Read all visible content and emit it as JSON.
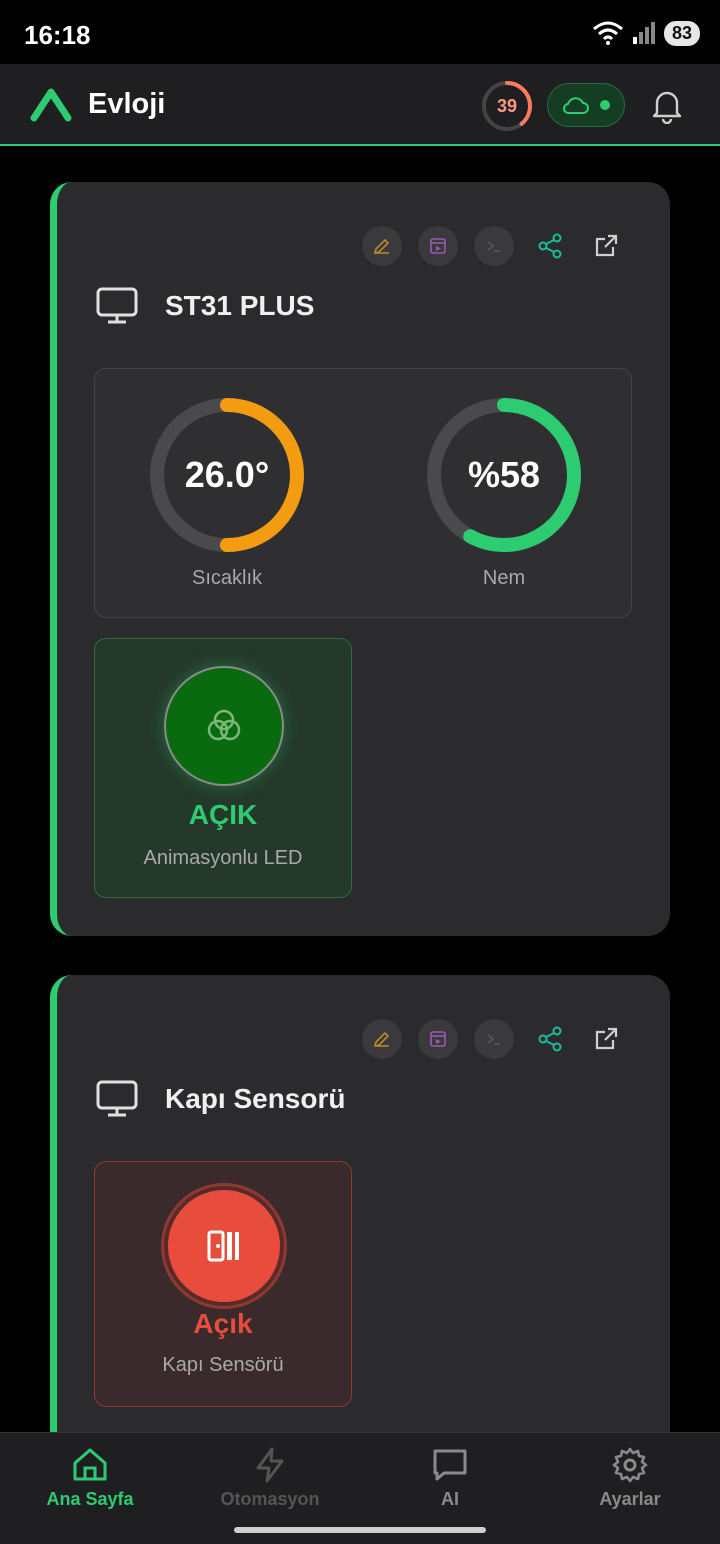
{
  "status": {
    "time": "16:18",
    "battery": "83"
  },
  "header": {
    "title": "Evloji",
    "score": "39",
    "score_fraction": 0.39
  },
  "colors": {
    "accent": "#2ecc71",
    "warm": "#f39c12",
    "danger": "#e74c3c",
    "card": "#2b2b2d"
  },
  "devices": [
    {
      "name": "ST31 PLUS",
      "gauges": [
        {
          "value": "26.0°",
          "label": "Sıcaklık",
          "fraction": 0.5,
          "color": "#f39c12"
        },
        {
          "value": "%58",
          "label": "Nem",
          "fraction": 0.58,
          "color": "#2ecc71"
        }
      ],
      "tile": {
        "state": "AÇIK",
        "name": "Animasyonlu LED"
      }
    },
    {
      "name": "Kapı Sensorü",
      "tile": {
        "state": "Açık",
        "name": "Kapı Sensörü"
      }
    }
  ],
  "tool_icons": [
    "edit-icon",
    "media-icon",
    "terminal-icon",
    "share-icon",
    "external-link-icon"
  ],
  "nav": [
    {
      "label": "Ana Sayfa",
      "icon": "home-icon",
      "active": true
    },
    {
      "label": "Otomasyon",
      "icon": "lightning-icon",
      "active": false
    },
    {
      "label": "AI",
      "icon": "chat-icon",
      "active": false
    },
    {
      "label": "Ayarlar",
      "icon": "gear-icon",
      "active": false
    }
  ]
}
